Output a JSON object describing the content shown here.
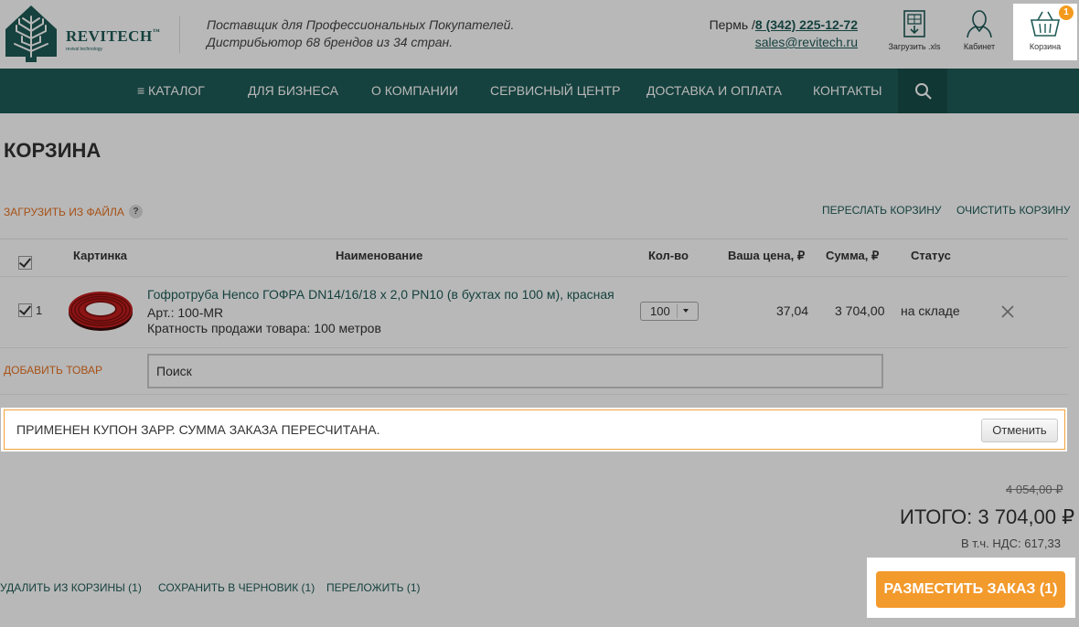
{
  "header": {
    "logo_name": "REVITECH",
    "logo_tm": "™",
    "logo_tagline": "revival technology",
    "tagline_line1": "Поставщик для Профессиональных Покупателей.",
    "tagline_line2": "Дистрибьютор 68 брендов из 34 стран.",
    "city": "Пермь /",
    "phone": "8 (342) 225-12-72",
    "email": "sales@revitech.ru",
    "upload_xls_label": "Загрузить .xls",
    "cabinet_label": "Кабинет",
    "cart_label": "Корзина",
    "cart_count": "1"
  },
  "nav": {
    "catalog": "≡ КАТАЛОГ",
    "business": "ДЛЯ БИЗНЕСА",
    "about": "О КОМПАНИИ",
    "service": "СЕРВИСНЫЙ ЦЕНТР",
    "delivery": "ДОСТАВКА И ОПЛАТА",
    "contacts": "КОНТАКТЫ"
  },
  "page": {
    "title": "КОРЗИНА",
    "upload_from_file": "ЗАГРУЗИТЬ ИЗ ФАЙЛА",
    "help": "?",
    "forward_cart": "ПЕРЕСЛАТЬ КОРЗИНУ",
    "clear_cart": "ОЧИСТИТЬ КОРЗИНУ"
  },
  "table": {
    "columns": {
      "picture": "Картинка",
      "name": "Наименование",
      "qty": "Кол-во",
      "price": "Ваша цена, ₽",
      "sum": "Сумма, ₽",
      "status": "Статус"
    },
    "rows": [
      {
        "num": "1",
        "name": "Гофротруба Henco ГОФРА DN14/16/18 х 2,0 PN10 (в бухтах по 100 м), красная",
        "article": "Арт.: 100-MR",
        "multiplicity": "Кратность продажи товара: 100 метров",
        "qty": "100",
        "price": "37,04",
        "sum": "3 704,00",
        "status": "на складе"
      }
    ]
  },
  "add_item": {
    "label": "ДОБАВИТЬ ТОВАР",
    "placeholder": "Поиск"
  },
  "coupon": {
    "message": "ПРИМЕНЕН КУПОН ЗАРР. СУММА ЗАКАЗА ПЕРЕСЧИТАНА.",
    "cancel_label": "Отменить"
  },
  "totals": {
    "old_total": "4 054,00 ₽",
    "total": "ИТОГО: 3 704,00 ₽",
    "vat": "В т.ч. НДС: 617,33"
  },
  "actions": {
    "delete": "УДАЛИТЬ ИЗ КОРЗИНЫ (1)",
    "save_draft": "СОХРАНИТЬ В ЧЕРНОВИК (1)",
    "move": "ПЕРЕЛОЖИТЬ (1)",
    "place_order": "РАЗМЕСТИТЬ ЗАКАЗ (1)"
  },
  "colors": {
    "brand_teal": "#1e5b57",
    "accent_orange": "#f39a2c",
    "link_orange": "#e8711f",
    "coupon_border": "#f0a33a"
  }
}
